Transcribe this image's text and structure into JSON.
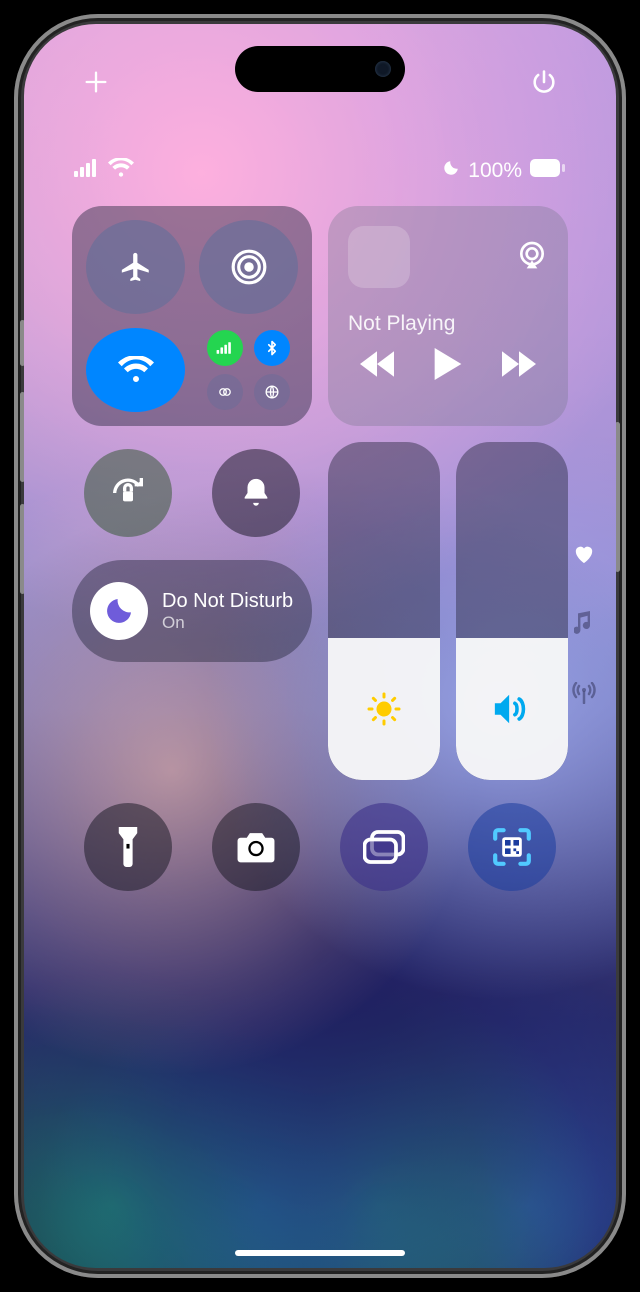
{
  "top": {
    "add_label": "+"
  },
  "status": {
    "battery_pct": "100%",
    "dnd_active": true
  },
  "media": {
    "now": "Not Playing"
  },
  "focus": {
    "title": "Do Not Disturb",
    "state": "On"
  },
  "sliders": {
    "brightness_pct": 42,
    "volume_pct": 42
  },
  "connectivity": {
    "airplane": false,
    "airdrop": false,
    "wifi": true,
    "cellular": true,
    "bluetooth": true
  }
}
